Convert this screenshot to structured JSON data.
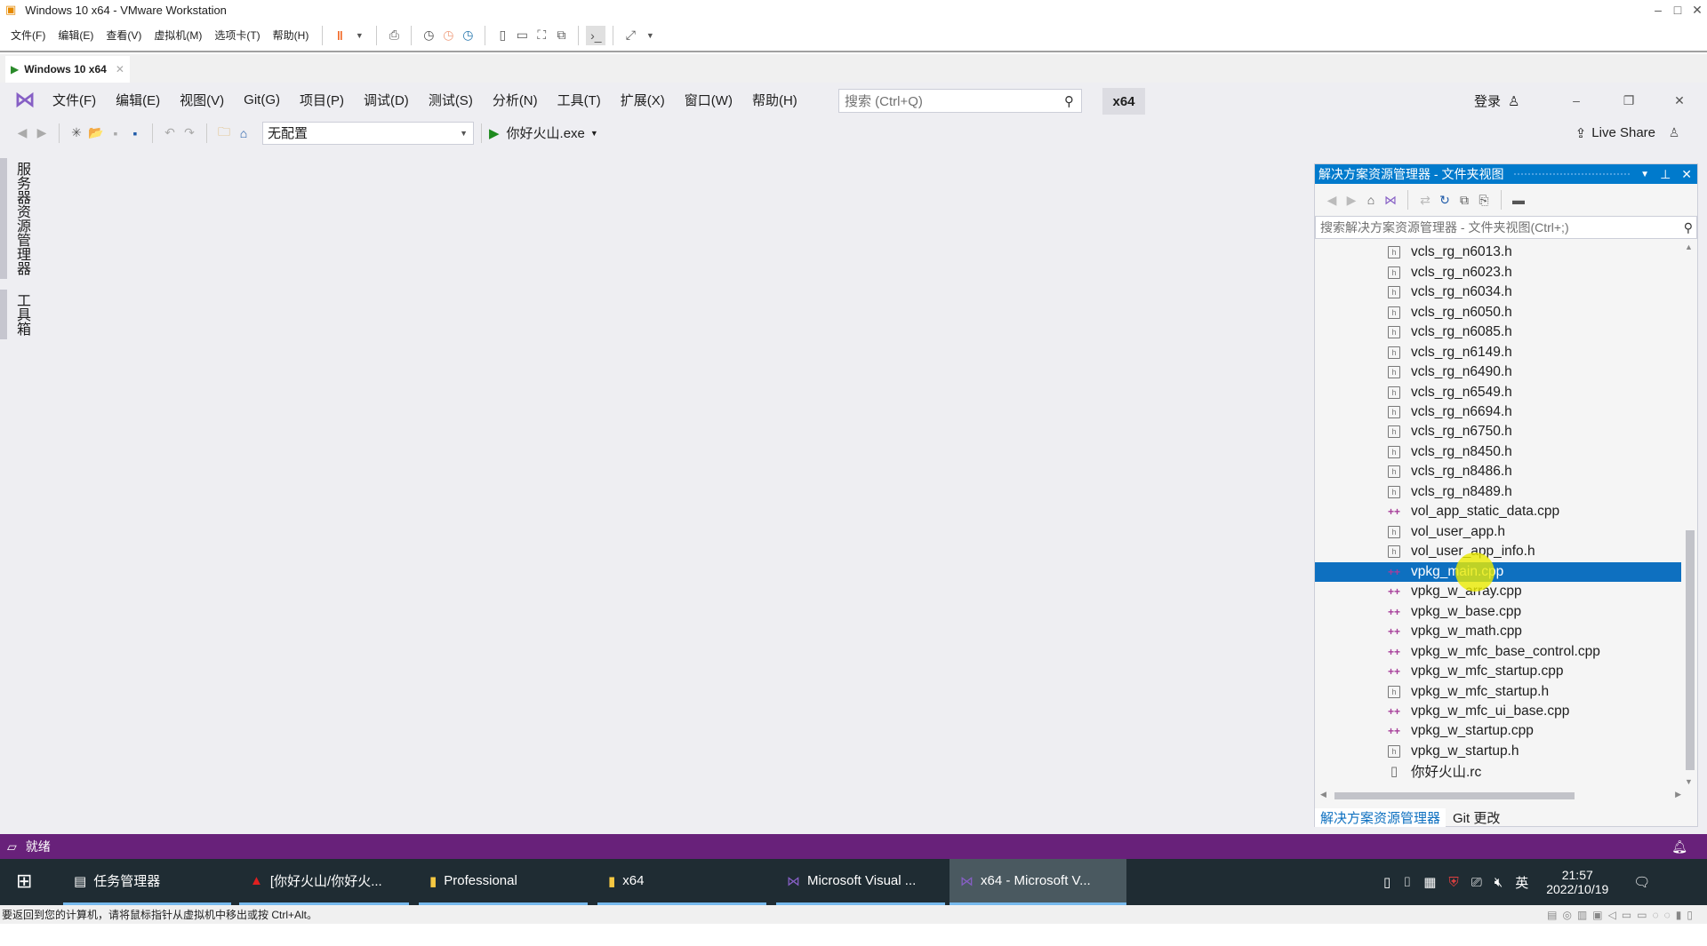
{
  "vmware": {
    "title": "Windows 10 x64 - VMware Workstation",
    "menu": [
      "文件(F)",
      "编辑(E)",
      "查看(V)",
      "虚拟机(M)",
      "选项卡(T)",
      "帮助(H)"
    ],
    "tab": "Windows 10 x64",
    "status": "要返回到您的计算机，请将鼠标指针从虚拟机中移出或按 Ctrl+Alt。"
  },
  "vs": {
    "menu": [
      "文件(F)",
      "编辑(E)",
      "视图(V)",
      "Git(G)",
      "项目(P)",
      "调试(D)",
      "测试(S)",
      "分析(N)",
      "工具(T)",
      "扩展(X)",
      "窗口(W)",
      "帮助(H)"
    ],
    "search_placeholder": "搜索 (Ctrl+Q)",
    "platform": "x64",
    "login": "登录",
    "live_share": "Live Share",
    "config": "无配置",
    "run_target": "你好火山.exe",
    "side_tabs": [
      "服务器资源管理器",
      "工具箱"
    ],
    "status": "就绪"
  },
  "solution_explorer": {
    "title": "解决方案资源管理器 - 文件夹视图",
    "search_placeholder": "搜索解决方案资源管理器 - 文件夹视图(Ctrl+;)",
    "items": [
      {
        "name": "vcls_rg_n6013.h",
        "type": "h"
      },
      {
        "name": "vcls_rg_n6023.h",
        "type": "h"
      },
      {
        "name": "vcls_rg_n6034.h",
        "type": "h"
      },
      {
        "name": "vcls_rg_n6050.h",
        "type": "h"
      },
      {
        "name": "vcls_rg_n6085.h",
        "type": "h"
      },
      {
        "name": "vcls_rg_n6149.h",
        "type": "h"
      },
      {
        "name": "vcls_rg_n6490.h",
        "type": "h"
      },
      {
        "name": "vcls_rg_n6549.h",
        "type": "h"
      },
      {
        "name": "vcls_rg_n6694.h",
        "type": "h"
      },
      {
        "name": "vcls_rg_n6750.h",
        "type": "h"
      },
      {
        "name": "vcls_rg_n8450.h",
        "type": "h"
      },
      {
        "name": "vcls_rg_n8486.h",
        "type": "h"
      },
      {
        "name": "vcls_rg_n8489.h",
        "type": "h"
      },
      {
        "name": "vol_app_static_data.cpp",
        "type": "cpp"
      },
      {
        "name": "vol_user_app.h",
        "type": "h"
      },
      {
        "name": "vol_user_app_info.h",
        "type": "h"
      },
      {
        "name": "vpkg_main.cpp",
        "type": "cpp",
        "selected": true
      },
      {
        "name": "vpkg_w_array.cpp",
        "type": "cpp"
      },
      {
        "name": "vpkg_w_base.cpp",
        "type": "cpp"
      },
      {
        "name": "vpkg_w_math.cpp",
        "type": "cpp"
      },
      {
        "name": "vpkg_w_mfc_base_control.cpp",
        "type": "cpp"
      },
      {
        "name": "vpkg_w_mfc_startup.cpp",
        "type": "cpp"
      },
      {
        "name": "vpkg_w_mfc_startup.h",
        "type": "h"
      },
      {
        "name": "vpkg_w_mfc_ui_base.cpp",
        "type": "cpp"
      },
      {
        "name": "vpkg_w_startup.cpp",
        "type": "cpp"
      },
      {
        "name": "vpkg_w_startup.h",
        "type": "h"
      },
      {
        "name": "你好火山.rc",
        "type": "rc"
      }
    ],
    "tabs": [
      "解决方案资源管理器",
      "Git 更改"
    ]
  },
  "taskbar": {
    "items": [
      "任务管理器",
      "[你好火山/你好火...",
      "Professional",
      "x64",
      "Microsoft Visual ...",
      "x64 - Microsoft V..."
    ],
    "time": "21:57",
    "date": "2022/10/19",
    "ime": "英"
  },
  "colors": {
    "accent": "#007acc",
    "status_bar": "#68217a",
    "selection": "#0e70c0"
  }
}
